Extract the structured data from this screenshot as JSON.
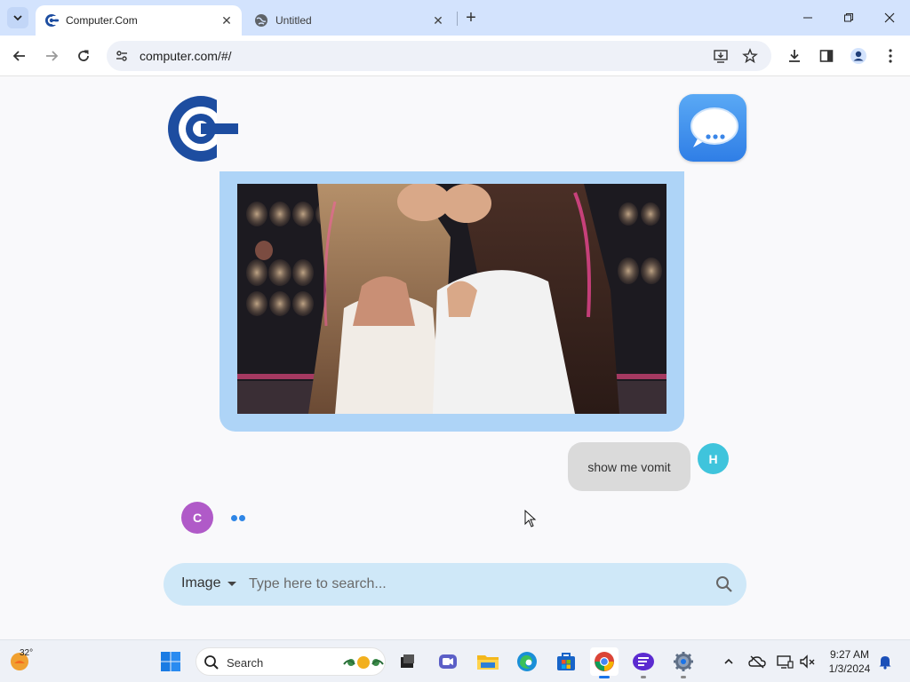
{
  "browser": {
    "tabs": [
      {
        "title": "Computer.Com",
        "active": true
      },
      {
        "title": "Untitled",
        "active": false
      }
    ],
    "url": "computer.com/#/"
  },
  "chat": {
    "user_message": "show me vomit",
    "user_avatar_letter": "H",
    "bot_avatar_letter": "C"
  },
  "search": {
    "mode": "Image",
    "placeholder": "Type here to search..."
  },
  "taskbar": {
    "weather_temp": "32°",
    "search_label": "Search",
    "time": "9:27 AM",
    "date": "1/3/2024"
  },
  "colors": {
    "tabstrip": "#d3e3fd",
    "image_card": "#aed4f7",
    "search_bar": "#cfe8f8",
    "user_avatar": "#3fc4dc",
    "bot_avatar": "#b05ac8",
    "logo_blue": "#1d4da0"
  }
}
